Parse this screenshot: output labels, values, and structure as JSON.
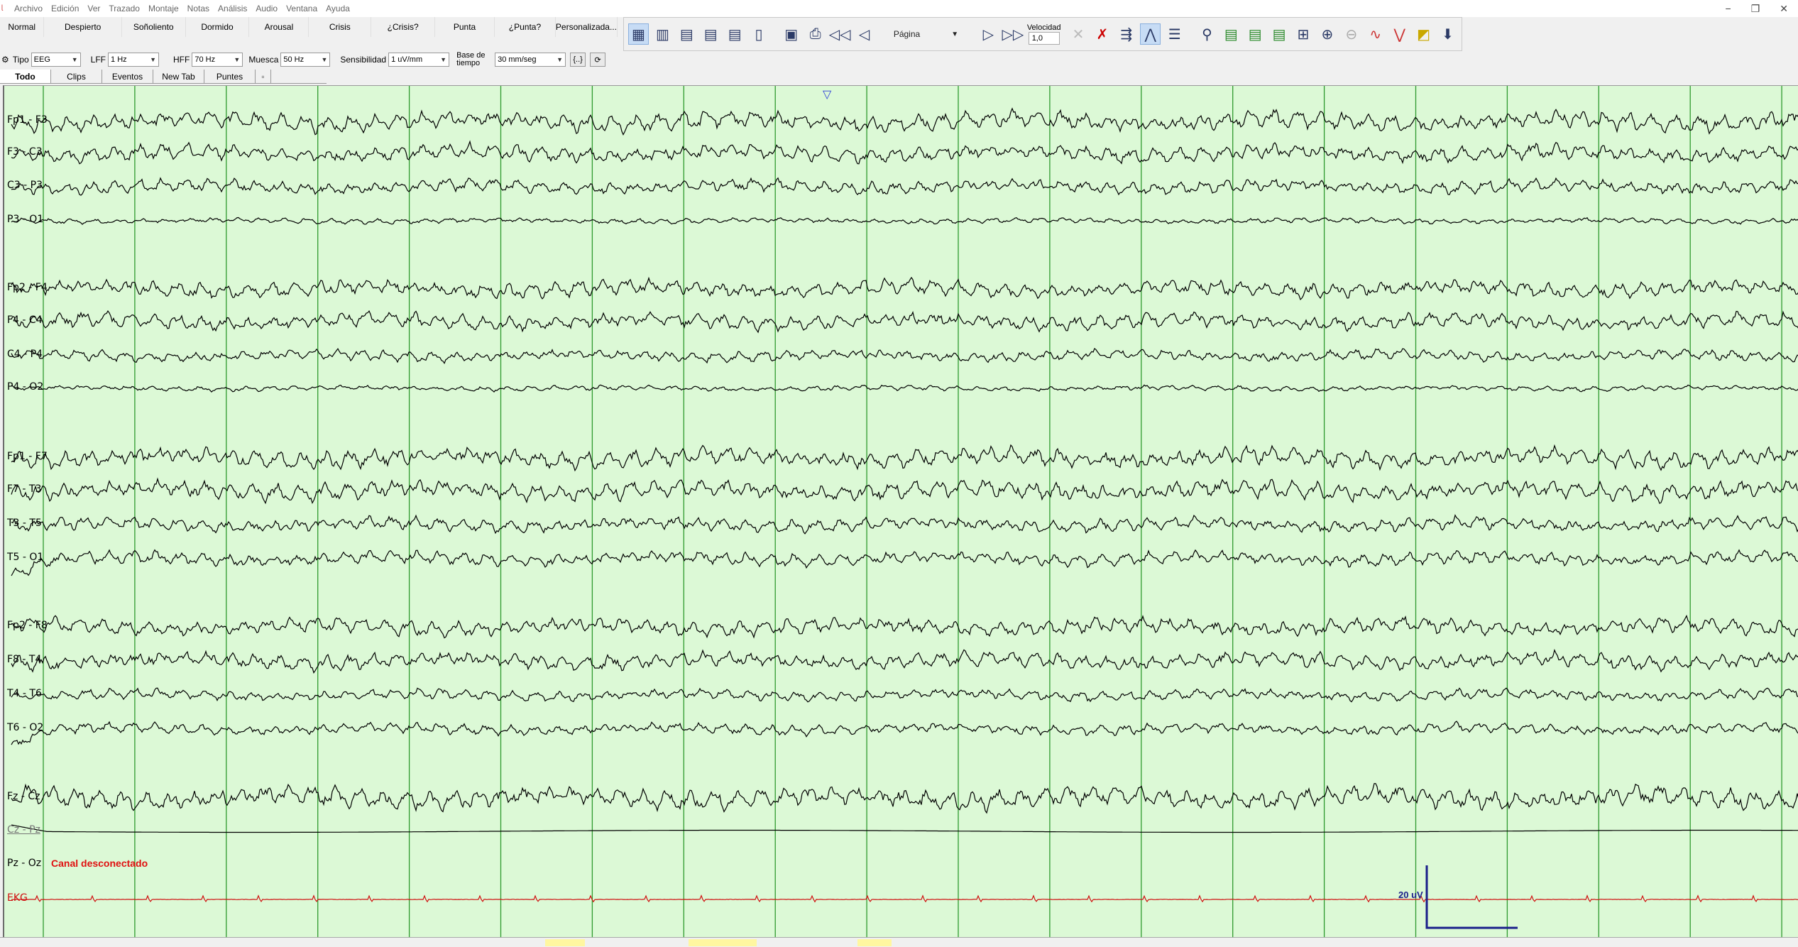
{
  "menu": [
    "Archivo",
    "Edición",
    "Ver",
    "Trazado",
    "Montaje",
    "Notas",
    "Análisis",
    "Audio",
    "Ventana",
    "Ayuda"
  ],
  "window_controls": [
    "−",
    "❐",
    "✕"
  ],
  "state_buttons": [
    "Normal",
    "Despierto",
    "Soñoliento",
    "Dormido",
    "Arousal",
    "Crisis",
    "¿Crisis?",
    "Punta",
    "¿Punta?",
    "Personalizada..."
  ],
  "toolbar": {
    "pagina": "Página",
    "velocidad_label": "Velocidad",
    "velocidad_value": "1,0"
  },
  "filters": {
    "tipo_label": "Tipo",
    "tipo_value": "EEG",
    "lff_label": "LFF",
    "lff_value": "1 Hz",
    "hff_label": "HFF",
    "hff_value": "70 Hz",
    "muesca_label": "Muesca",
    "muesca_value": "50 Hz",
    "sensibilidad_label": "Sensibilidad",
    "sensibilidad_value": "1 uV/mm",
    "base_label": "Base de tiempo",
    "base_value": "30 mm/seg"
  },
  "tabs": [
    "Todo",
    "Clips",
    "Eventos",
    "New Tab",
    "Puntes"
  ],
  "channels": [
    {
      "label": "Fp1 - F3",
      "amp": 7,
      "type": "eeg"
    },
    {
      "label": "F3 - C3",
      "amp": 6,
      "type": "eeg"
    },
    {
      "label": "C3 - P3",
      "amp": 5,
      "type": "eeg"
    },
    {
      "label": "P3 - O1",
      "amp": 2,
      "type": "eeg"
    },
    {
      "label": "Fp2 - F4",
      "amp": 6,
      "type": "eeg"
    },
    {
      "label": "F4 - C4",
      "amp": 6,
      "type": "eeg"
    },
    {
      "label": "C4 - P4",
      "amp": 4,
      "type": "eeg"
    },
    {
      "label": "P4 - O2",
      "amp": 2,
      "type": "eeg"
    },
    {
      "label": "Fp1 - F7",
      "amp": 7,
      "type": "eeg"
    },
    {
      "label": "F7 - T3",
      "amp": 7,
      "type": "eeg"
    },
    {
      "label": "T3 - T5",
      "amp": 5,
      "type": "eeg"
    },
    {
      "label": "T5 - O1",
      "amp": 5,
      "type": "eeg"
    },
    {
      "label": "Fp2 - F8",
      "amp": 6,
      "type": "eeg"
    },
    {
      "label": "F8 - T4",
      "amp": 6,
      "type": "eeg"
    },
    {
      "label": "T4 - T6",
      "amp": 4,
      "type": "eeg"
    },
    {
      "label": "T6 - O2",
      "amp": 4,
      "type": "eeg"
    },
    {
      "label": "Fz - Cz",
      "amp": 8,
      "type": "eeg"
    },
    {
      "label": "Cz - Pz",
      "amp": 1,
      "type": "disconnected-trace"
    },
    {
      "label": "Pz - Oz",
      "amp": 0,
      "type": "none"
    },
    {
      "label": "EKG",
      "amp": 2,
      "type": "ekg"
    }
  ],
  "disconnected_text": "Canal desconectado",
  "calibration_label": "20 uV",
  "colors": {
    "background": "#dcf9d6",
    "gridline": "#2f9a2f",
    "trace": "#000000",
    "ekg": "#d01010",
    "calibration": "#1a1f8a"
  }
}
